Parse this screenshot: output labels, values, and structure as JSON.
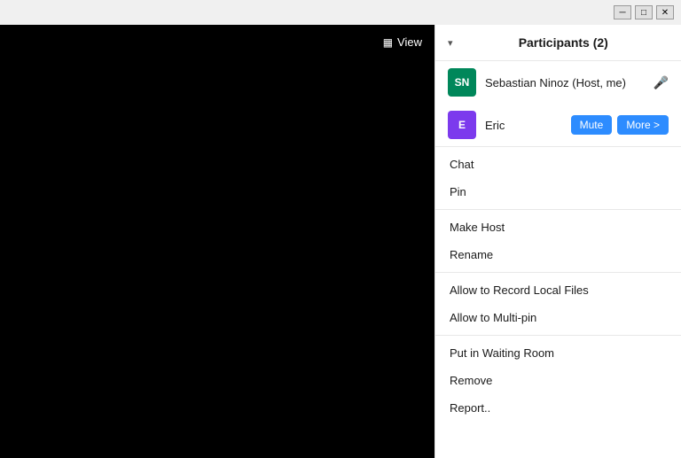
{
  "titlebar": {
    "minimize_label": "─",
    "maximize_label": "□",
    "close_label": "✕"
  },
  "video": {
    "view_label": "View",
    "view_icon": "▦"
  },
  "panel": {
    "title": "Participants (2)",
    "collapse_arrow": "▾"
  },
  "participants": [
    {
      "initials": "SN",
      "name": "Sebastian Ninoz (Host, me)",
      "avatar_class": "avatar-sn",
      "show_mic": true,
      "show_buttons": false
    },
    {
      "initials": "E",
      "name": "Eric",
      "avatar_class": "avatar-e",
      "show_mic": false,
      "show_buttons": true
    }
  ],
  "buttons": {
    "mute": "Mute",
    "more": "More >"
  },
  "menu_groups": [
    {
      "items": [
        "Chat",
        "Pin"
      ]
    },
    {
      "items": [
        "Make Host",
        "Rename"
      ]
    },
    {
      "items": [
        "Allow to Record Local Files",
        "Allow to Multi-pin"
      ]
    },
    {
      "items": [
        "Put in Waiting Room",
        "Remove",
        "Report.."
      ]
    }
  ]
}
